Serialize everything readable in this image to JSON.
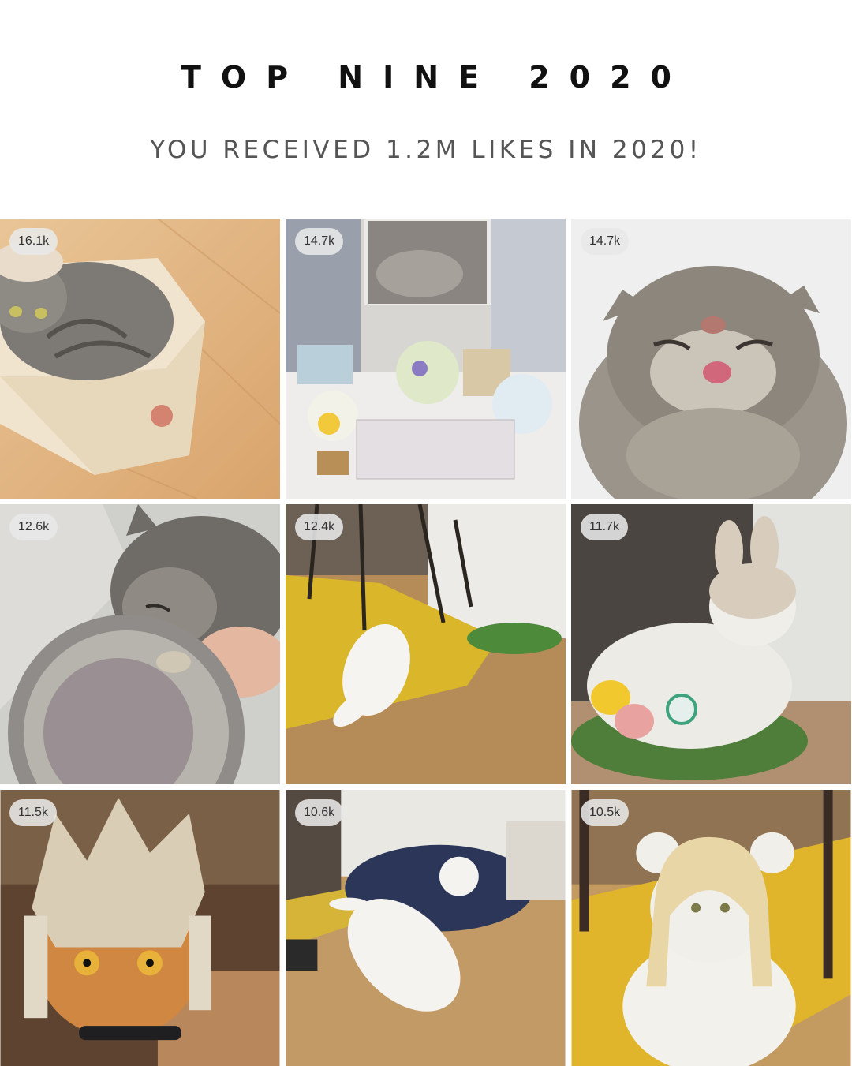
{
  "title": "TOP NINE 2020",
  "subtitle": "YOU RECEIVED 1.2M LIKES IN 2020!",
  "posts": [
    {
      "likes": "16.1k",
      "subject": "cat in cardboard box"
    },
    {
      "likes": "14.7k",
      "subject": "memorial altar with flowers"
    },
    {
      "likes": "14.7k",
      "subject": "cat sticking out tongue"
    },
    {
      "likes": "12.6k",
      "subject": "sleepy cat with tin"
    },
    {
      "likes": "12.4k",
      "subject": "white cat lying on floor"
    },
    {
      "likes": "11.7k",
      "subject": "white cat with bunny hat"
    },
    {
      "likes": "11.5k",
      "subject": "orange cat with spiky wig"
    },
    {
      "likes": "10.6k",
      "subject": "white cat lying on back"
    },
    {
      "likes": "10.5k",
      "subject": "white cat with blonde wig"
    }
  ]
}
